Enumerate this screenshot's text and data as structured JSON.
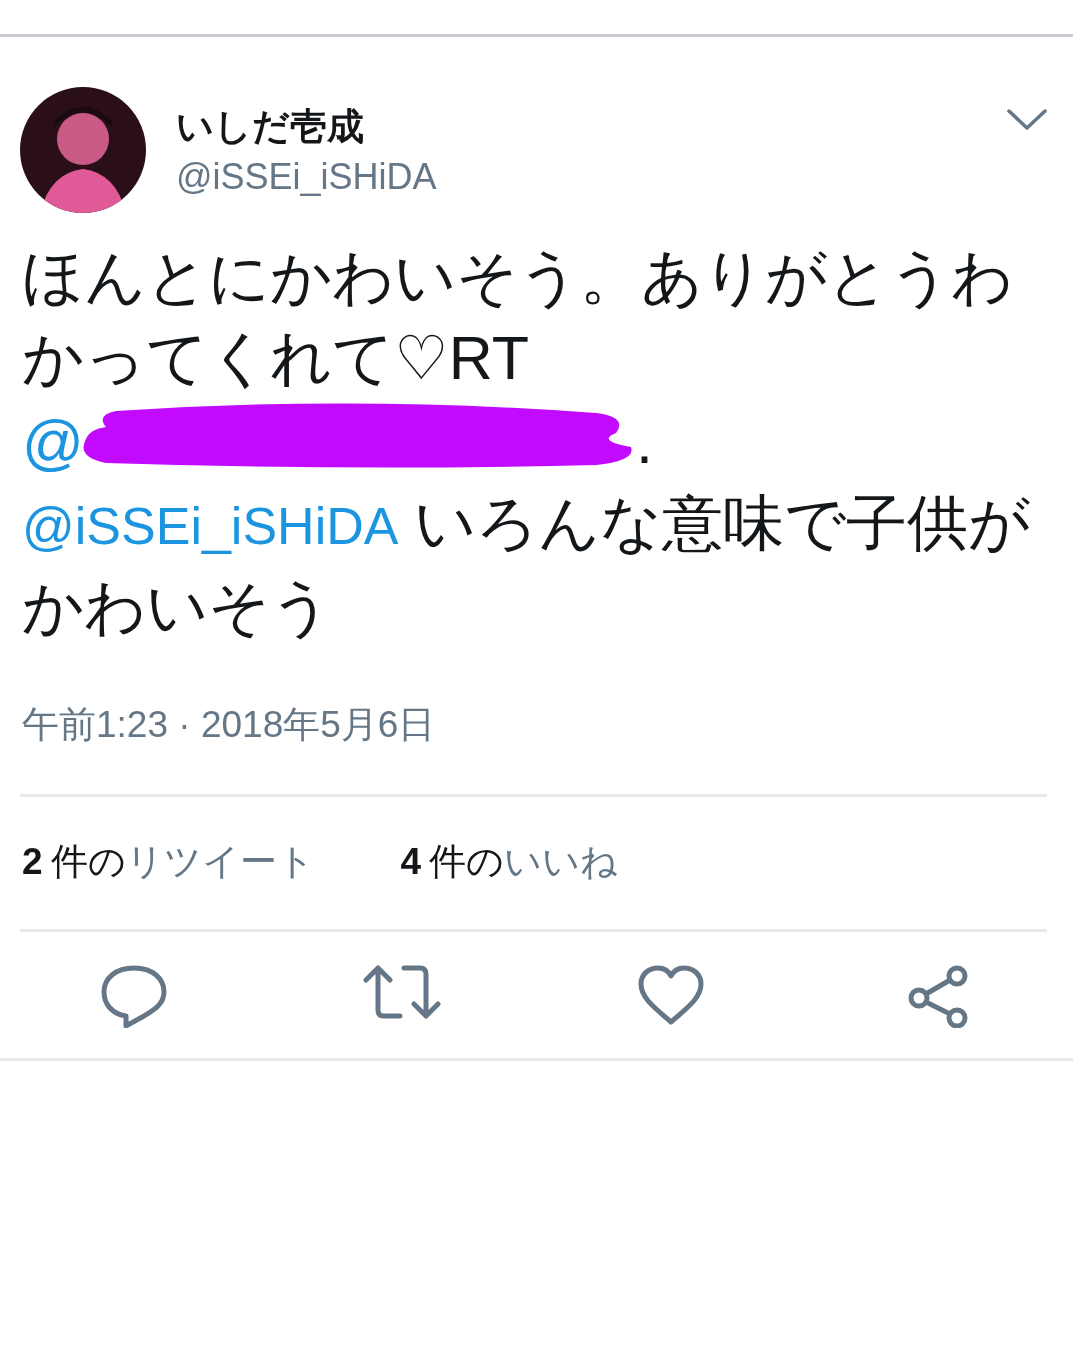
{
  "tweet": {
    "author": {
      "name": "いしだ壱成",
      "handle": "@iSSEi_iSHiDA"
    },
    "body": [
      [
        {
          "kind": "text",
          "text": "ほんとにかわいそう。ありがとうわかってくれて♡RT"
        }
      ],
      [
        {
          "kind": "redacted_mention",
          "text": "@"
        },
        {
          "kind": "text",
          "text": "."
        }
      ],
      [
        {
          "kind": "mention",
          "text": "@iSSEi_iSHiDA"
        },
        {
          "kind": "text",
          "text": "いろんな意味で子供がかわいそう"
        }
      ]
    ],
    "timestamp": "午前1:23 · 2018年5月6日",
    "stats": [
      {
        "count": "2",
        "unit": "件の",
        "label": "リツイート"
      },
      {
        "count": "4",
        "unit": "件の",
        "label": "いいね"
      }
    ],
    "actions": [
      {
        "kind": "reply"
      },
      {
        "kind": "retweet"
      },
      {
        "kind": "like"
      },
      {
        "kind": "share"
      }
    ]
  }
}
